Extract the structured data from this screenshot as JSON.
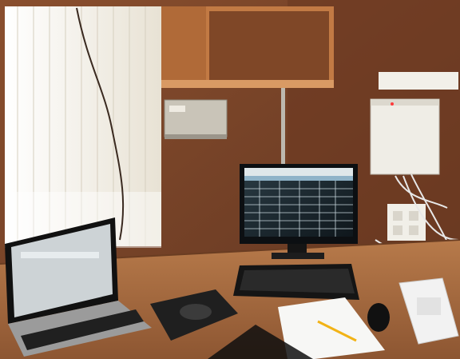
{
  "photo": {
    "subject": "office-desk",
    "colors": {
      "wall": "#7a4528",
      "desk": "#a86a3e",
      "blinds": "#f3f0e8",
      "cabinet": "#efede6",
      "monitor_screen": "#1b2a33",
      "laptop_screen": "#cdd3d6"
    },
    "objects": [
      "window-blinds",
      "wall-cabinet",
      "network-box",
      "desktop-monitor",
      "keyboard",
      "laptop",
      "mousepad",
      "mouse",
      "paper-sheet",
      "pencil",
      "desk-phone",
      "power-strip",
      "cables"
    ]
  }
}
